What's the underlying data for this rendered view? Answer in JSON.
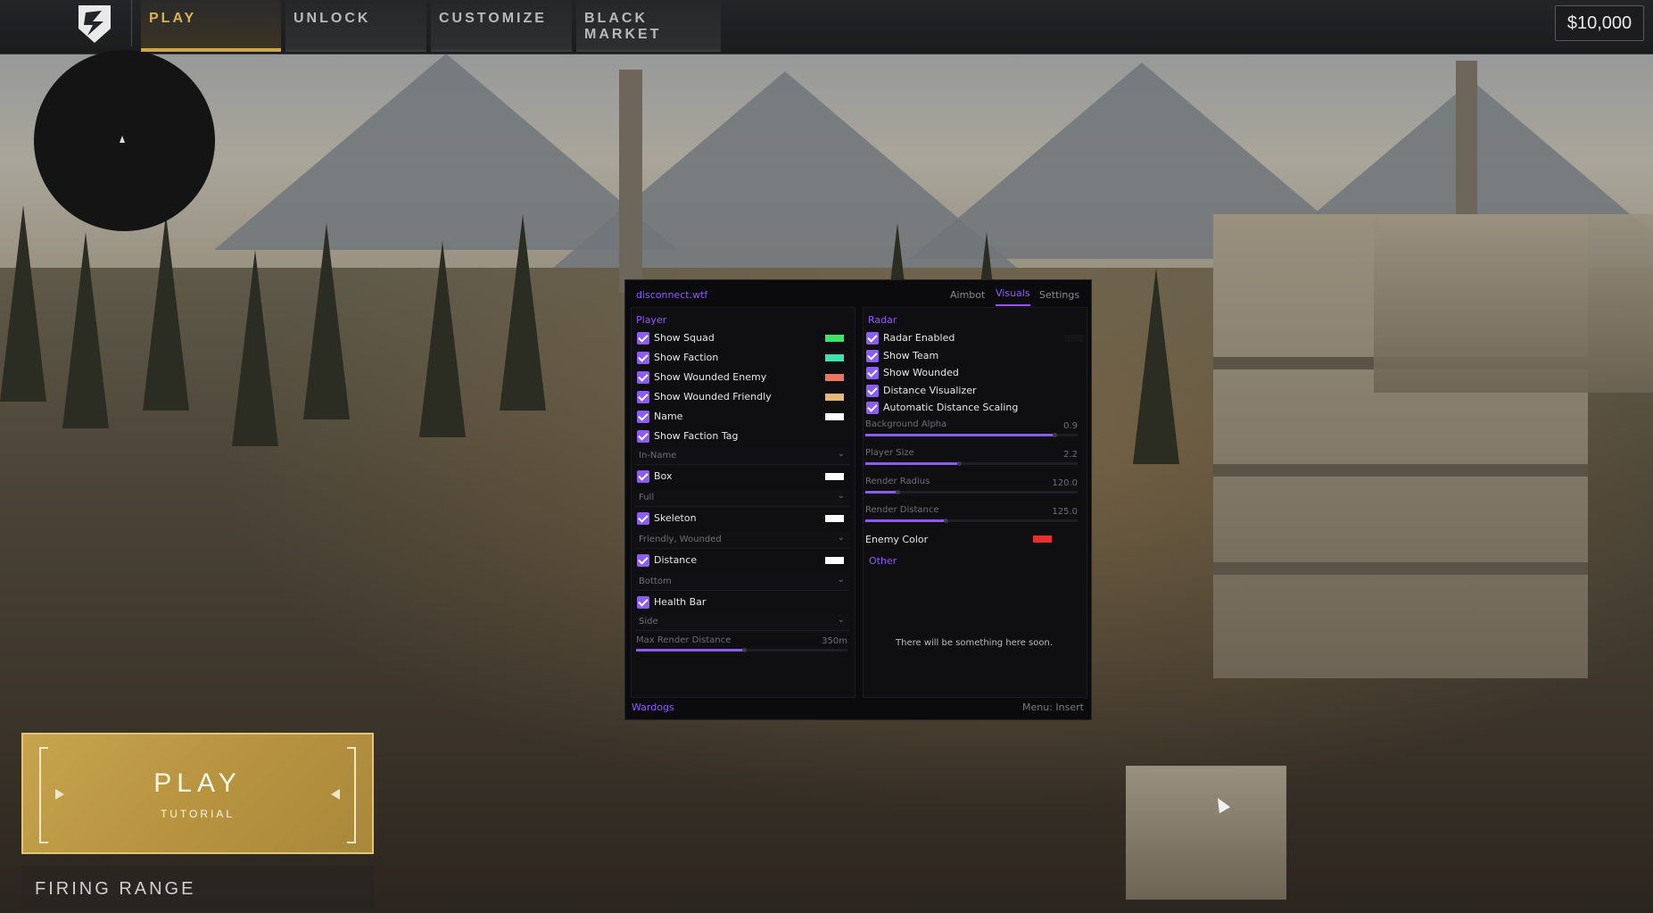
{
  "topbar": {
    "tabs": [
      {
        "label": "PLAY",
        "active": true
      },
      {
        "label": "UNLOCK",
        "active": false
      },
      {
        "label": "CUSTOMIZE",
        "active": false
      },
      {
        "label": "BLACK MARKET",
        "active": false
      }
    ],
    "currency": "$10,000"
  },
  "menu": {
    "title": "disconnect.wtf",
    "tabs": [
      "Aimbot",
      "Visuals",
      "Settings"
    ],
    "active_tab": "Visuals",
    "player": {
      "section": "Player",
      "items": [
        {
          "label": "Show Squad",
          "checked": true,
          "color": "#3ee36b"
        },
        {
          "label": "Show Faction",
          "checked": true,
          "color": "#3fe3b0"
        },
        {
          "label": "Show Wounded Enemy",
          "checked": true,
          "color": "#e97562"
        },
        {
          "label": "Show Wounded Friendly",
          "checked": true,
          "color": "#e6b87a"
        },
        {
          "label": "Name",
          "checked": true,
          "color": "#ffffff"
        },
        {
          "label": "Show Faction Tag",
          "checked": true
        }
      ],
      "name_mode": "In-Name",
      "box": {
        "label": "Box",
        "checked": true,
        "color": "#ffffff",
        "mode": "Full"
      },
      "skeleton": {
        "label": "Skeleton",
        "checked": true,
        "color": "#ffffff",
        "mode": "Friendly, Wounded"
      },
      "distance": {
        "label": "Distance",
        "checked": true,
        "color": "#ffffff",
        "mode": "Bottom"
      },
      "health": {
        "label": "Health Bar",
        "checked": true,
        "mode": "Side"
      },
      "max_render": {
        "label": "Max Render Distance",
        "value": "350m",
        "fraction": 0.51
      }
    },
    "radar": {
      "section": "Radar",
      "items": [
        {
          "label": "Radar Enabled",
          "checked": true
        },
        {
          "label": "Show Team",
          "checked": true
        },
        {
          "label": "Show Wounded",
          "checked": true
        },
        {
          "label": "Distance Visualizer",
          "checked": true
        },
        {
          "label": "Automatic Distance Scaling",
          "checked": true
        }
      ],
      "sliders": [
        {
          "label": "Background Alpha",
          "value": "0.9",
          "fraction": 0.89
        },
        {
          "label": "Player Size",
          "value": "2.2",
          "fraction": 0.44
        },
        {
          "label": "Render Radius",
          "value": "120.0",
          "fraction": 0.15
        },
        {
          "label": "Render Distance",
          "value": "125.0",
          "fraction": 0.38
        }
      ],
      "enemy_color": {
        "label": "Enemy Color",
        "color": "#e5302f"
      }
    },
    "other": {
      "section": "Other",
      "text": "There will be something here soon."
    },
    "footer": {
      "left": "Wardogs",
      "right": "Menu: Insert"
    }
  },
  "play_button": {
    "label": "PLAY",
    "sublabel": "TUTORIAL"
  },
  "firing_range": {
    "label": "FIRING RANGE"
  }
}
